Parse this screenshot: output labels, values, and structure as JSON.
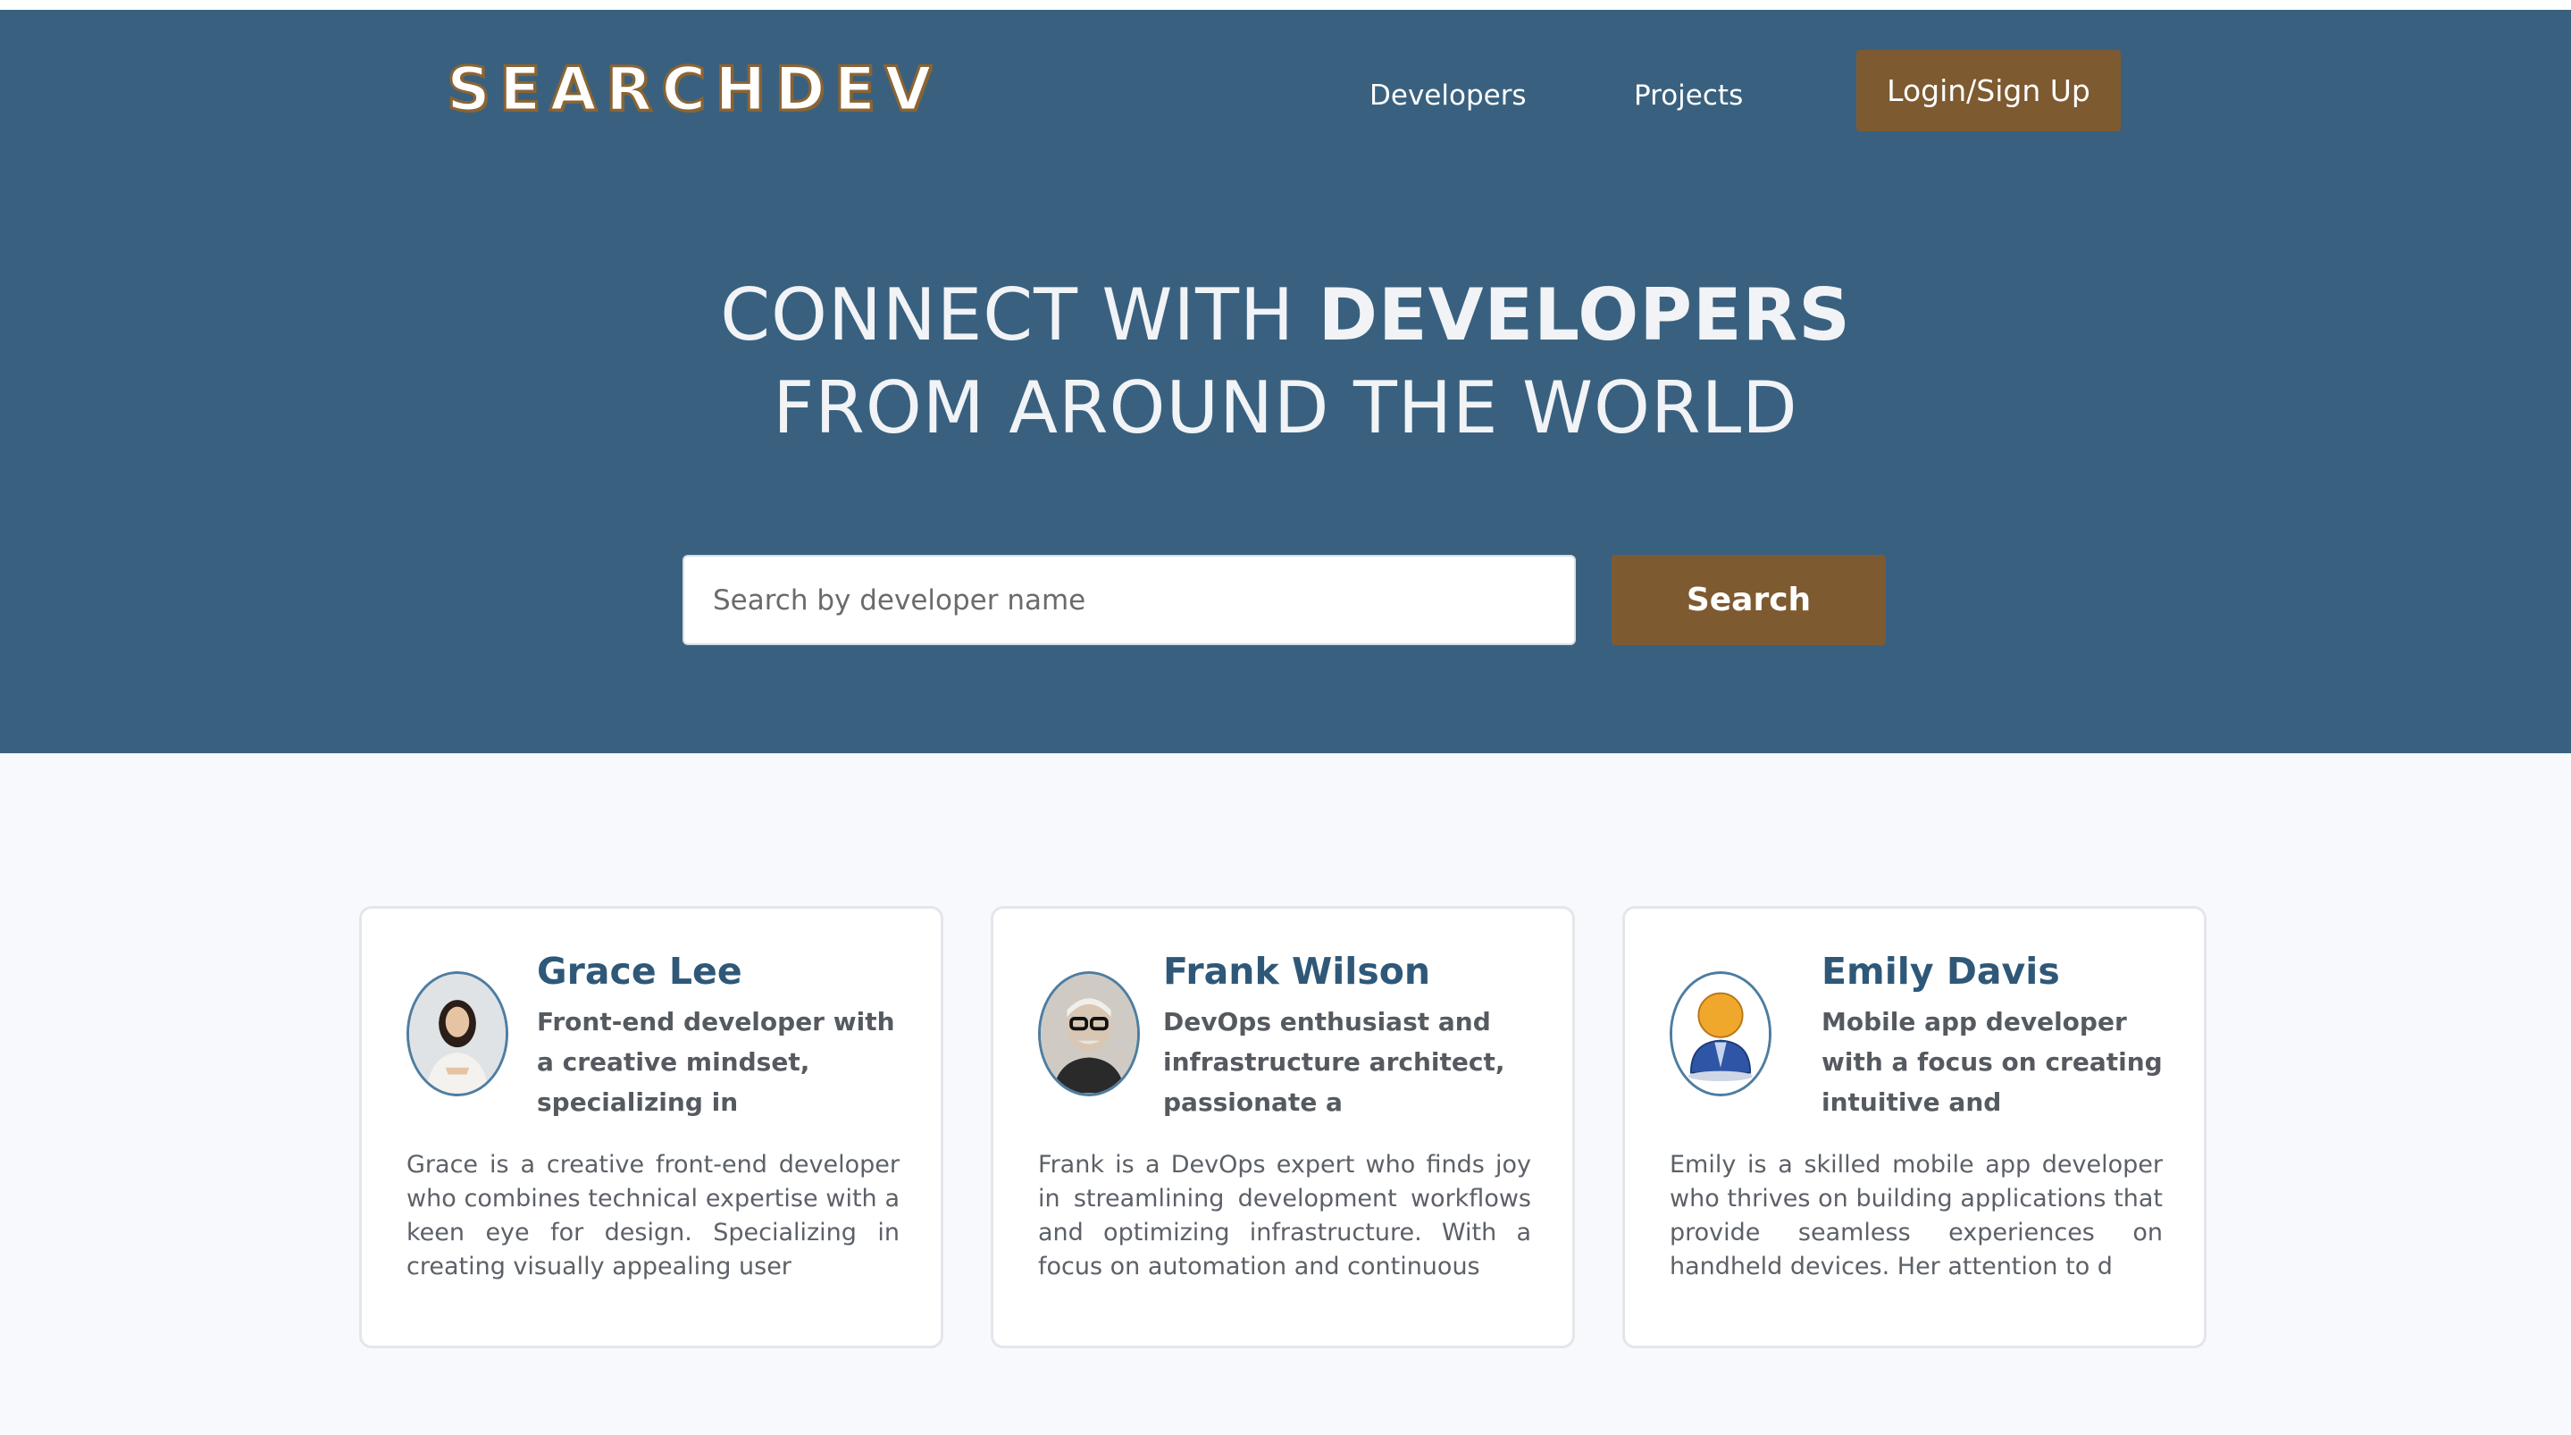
{
  "header": {
    "logo": "SEARCHDEV",
    "nav": {
      "developers": "Developers",
      "projects": "Projects",
      "login": "Login/Sign Up"
    }
  },
  "hero": {
    "line1_light": "CONNECT WITH ",
    "line1_bold": "DEVELOPERS",
    "line2": "FROM AROUND THE WORLD",
    "search_placeholder": "Search by developer name",
    "search_button": "Search"
  },
  "developers": [
    {
      "name": "Grace Lee",
      "role": "Front-end developer with a creative mindset, specializing in",
      "bio": "Grace is a creative front-end developer who combines technical expertise with a keen eye for design. Specializing in creating visually appealing user",
      "avatar": "woman-photo"
    },
    {
      "name": "Frank Wilson",
      "role": "DevOps enthusiast and infrastructure architect, passionate a",
      "bio": "Frank is a DevOps expert who finds joy in streamlining development workflows and optimizing infrastructure. With a focus on automation and continuous",
      "avatar": "man-photo"
    },
    {
      "name": "Emily Davis",
      "role": "Mobile app developer with a focus on creating intuitive and",
      "bio": "Emily is a skilled mobile app developer who thrives on building applications that provide seamless experiences on handheld devices. Her attention to d",
      "avatar": "default-user-icon"
    }
  ],
  "colors": {
    "hero_bg": "#39617f",
    "accent": "#7e5a31",
    "name_color": "#2f5878"
  }
}
